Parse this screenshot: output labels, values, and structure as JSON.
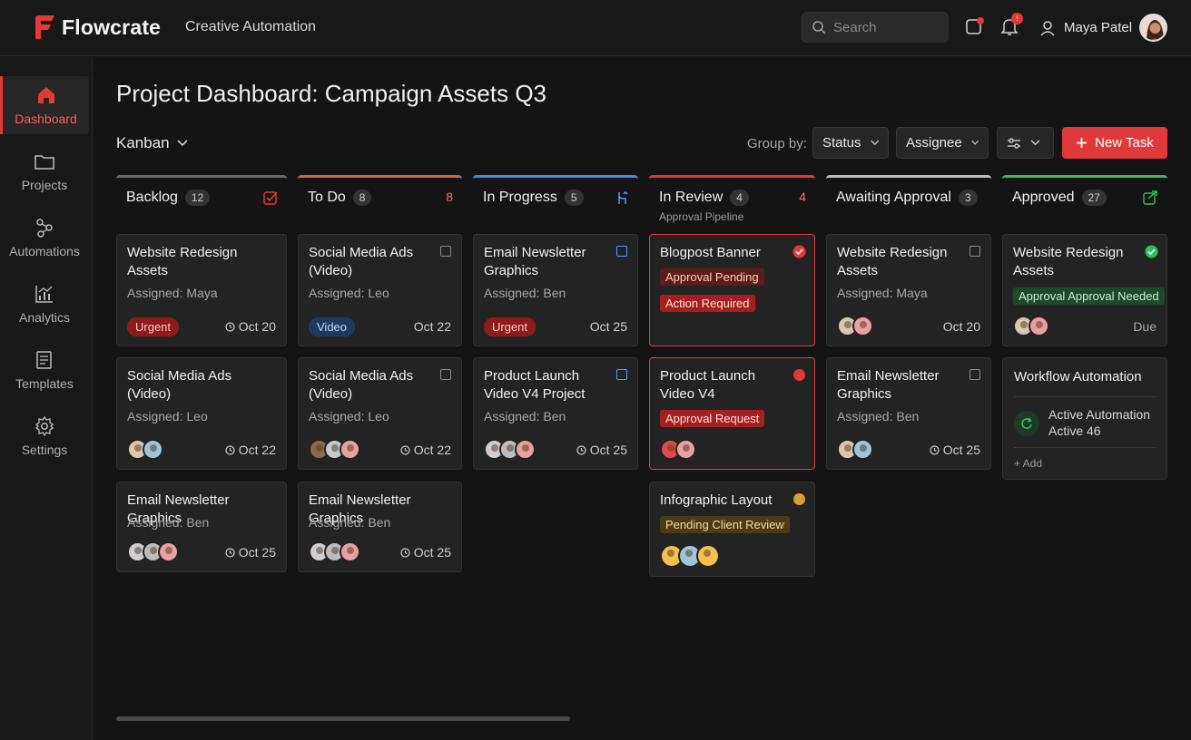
{
  "app": {
    "name": "Flowcrate",
    "tagline": "Creative Automation",
    "accent": "#e53935"
  },
  "header": {
    "search_placeholder": "Search",
    "notification_count": "!",
    "user_name": "Maya Patel"
  },
  "sidebar": {
    "items": [
      {
        "label": "Dashboard",
        "icon": "home-icon",
        "active": true
      },
      {
        "label": "Projects",
        "icon": "folder-icon"
      },
      {
        "label": "Automations",
        "icon": "automation-icon"
      },
      {
        "label": "Analytics",
        "icon": "analytics-icon"
      },
      {
        "label": "Templates",
        "icon": "templates-icon"
      },
      {
        "label": "Settings",
        "icon": "gear-icon"
      }
    ]
  },
  "page": {
    "title": "Project Dashboard: Campaign Assets Q3"
  },
  "toolbar": {
    "view": "Kanban",
    "group_by_label": "Group by:",
    "group_status": "Status",
    "group_assignee": "Assignee",
    "new_task": "New Task"
  },
  "columns": [
    {
      "title": "Backlog",
      "count": "12",
      "color": "#6b6b6b"
    },
    {
      "title": "To Do",
      "count": "8",
      "flag": "8",
      "color": "#c46a3c"
    },
    {
      "title": "In Progress",
      "count": "5",
      "color": "#3a8ee6"
    },
    {
      "title": "In Review",
      "count": "4",
      "flag": "4",
      "subtitle": "Approval Pipeline",
      "color": "#e53935"
    },
    {
      "title": "Awaiting Approval",
      "count": "3",
      "color": "#bdbdbd"
    },
    {
      "title": "Approved",
      "count": "27",
      "color": "#2fbf5a"
    }
  ],
  "cards": {
    "backlog": [
      {
        "title": "Website Redesign Assets",
        "assigned": "Assigned: Maya",
        "tag": "Urgent",
        "date": "Oct 20"
      },
      {
        "title": "Social Media Ads (Video)",
        "assigned": "Assigned: Leo",
        "date": "Oct 22"
      },
      {
        "title": "Email Newsletter Graphics",
        "assigned": "Assigned: Ben",
        "date": "Oct 25"
      }
    ],
    "todo": [
      {
        "title": "Social Media Ads (Video)",
        "assigned": "Assigned: Leo",
        "tag": "Video",
        "date": "Oct 22"
      },
      {
        "title": "Social Media Ads (Video)",
        "assigned": "Assigned: Leo",
        "date": "Oct 22"
      },
      {
        "title": "Email Newsletter Graphics",
        "assigned": "Assigned: Ben",
        "date": "Oct 25"
      }
    ],
    "progress": [
      {
        "title": "Email Newsletter Graphics",
        "assigned": "Assigned: Ben",
        "tag": "Urgent",
        "date": "Oct 25"
      },
      {
        "title": "Product Launch Video V4 Project",
        "assigned": "Assigned: Ben",
        "date": "Oct 25"
      }
    ],
    "review": [
      {
        "title": "Blogpost Banner",
        "badges": [
          "Approval Pending",
          "Action Required"
        ]
      },
      {
        "title": "Product Launch Video V4",
        "badges": [
          "Approval Request"
        ]
      },
      {
        "title": "Infographic Layout",
        "badges": [
          "Pending Client Review"
        ]
      }
    ],
    "awaiting": [
      {
        "title": "Website Redesign Assets",
        "assigned": "Assigned: Maya",
        "date": "Oct 20"
      },
      {
        "title": "Email Newsletter Graphics",
        "assigned": "Assigned: Ben",
        "date": "Oct 25"
      }
    ],
    "approved": [
      {
        "title": "Website Redesign Assets",
        "badge": "Approval Approval Needed",
        "due": "Due"
      }
    ]
  },
  "workflow": {
    "title": "Workflow Automation",
    "line1": "Active Automation",
    "line2": "Active 46",
    "add": "+ Add"
  }
}
